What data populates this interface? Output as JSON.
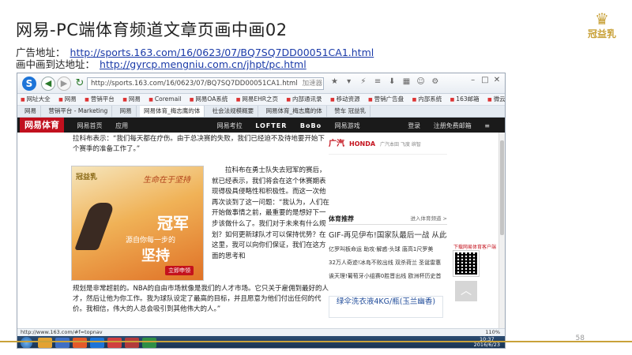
{
  "slide": {
    "title": "网易-PC端体育频道文章页画中画02",
    "ad_label": "广告地址：",
    "ad_url": "http://sports.163.com/16/0623/07/BQ7SQ7DD00051CA1.html",
    "target_label": "画中画到达地址：",
    "target_url": "http://gyrcp.mengniu.com.cn/jhpt/pc.html",
    "page_number": "58",
    "logo_text": "冠益乳"
  },
  "browser": {
    "url": "http://sports.163.com/16/0623/07/BQ7SQ7DD00051CA1.html",
    "security_label": "加速器",
    "bookmarks": [
      "网址大全",
      "网易",
      "营销平台",
      "网易",
      "Coremail",
      "网易OA系统",
      "网易EHR之页",
      "内部通讯录",
      "移动资源",
      "营销广告盘",
      "内部系统",
      "163邮箱",
      "微云_网易"
    ],
    "tabs": [
      "网易",
      "营销平台 - Marketing",
      "网易",
      "网易体育_梅志鹰的体",
      "社会法规模概要",
      "网易体育_梅志鹰的体",
      "赞车 冠益乳"
    ],
    "status_url": "http://www.163.com/#f=topnav",
    "zoom": "110%"
  },
  "site_nav": {
    "logo": "网易体育",
    "items": [
      "网易首页",
      "应用",
      "网易考拉",
      "LOFTER",
      "BoBo",
      "网易游戏",
      "登录",
      "注册免费邮箱"
    ]
  },
  "article": {
    "p1": "拉科布表示：“我们每天都在疗伤。由于总决赛的失败，我们已经迫不及待地要开始下个赛季的准备工作了。”",
    "p2": "拉科布在勇士队失去冠军的赛后，就已经表示，我们将会在这个休赛期表现得极具侵略性和积极性。而这一次他再次谈到了这一问题：“我认为，人们在开始做事情之前，最重要的是想好下一步该做什么了。我们对于未来有什么规划？如何更新球队才可以保持优势？在这里，我可以向你们保证，我们在这方面的思考和",
    "p3": "规划是非常超前的。NBA的自由市场就像是我们的人才市场。它只关于雇佣到最好的人才，然后让他为你工作。我为球队设定了最高的目标，并且愿意为他们付出任何的代价。我相信，伟大的人总会吸引到其他伟大的人。”"
  },
  "ad_creative": {
    "logo": "冠益乳",
    "slogan": "生命在于坚持",
    "headline": "冠军",
    "sub": "源自你每一步的",
    "headline2": "坚持",
    "button": "立即申领"
  },
  "sidebar": {
    "top_ad_brand": "广汽",
    "top_ad_honda": "HONDA",
    "top_ad_slogan": "广汽本田 飞度 缤智",
    "section_title": "体育推荐",
    "section_more": "进入体育频道 >",
    "headline": "GIF-再见伊布!国家队最后一战 从此再",
    "list": [
      "亿罗叫板命运 助攻·解惑·头球 唐高1尺罗美",
      "32万人奇迹!冰岛不败出线 双杀荷兰 圣诞雷惠",
      "诶天理!葡萄牙小组赛0胜晋出线 欧洲杯历史首"
    ],
    "qr_label": "下载网易体育客户端",
    "sticky_ad": "绿伞洗衣液4KG/瓶(玉兰幽香)",
    "scroll_top": "︿"
  },
  "taskbar": {
    "time": "10:37",
    "date": "2016/6/23"
  }
}
